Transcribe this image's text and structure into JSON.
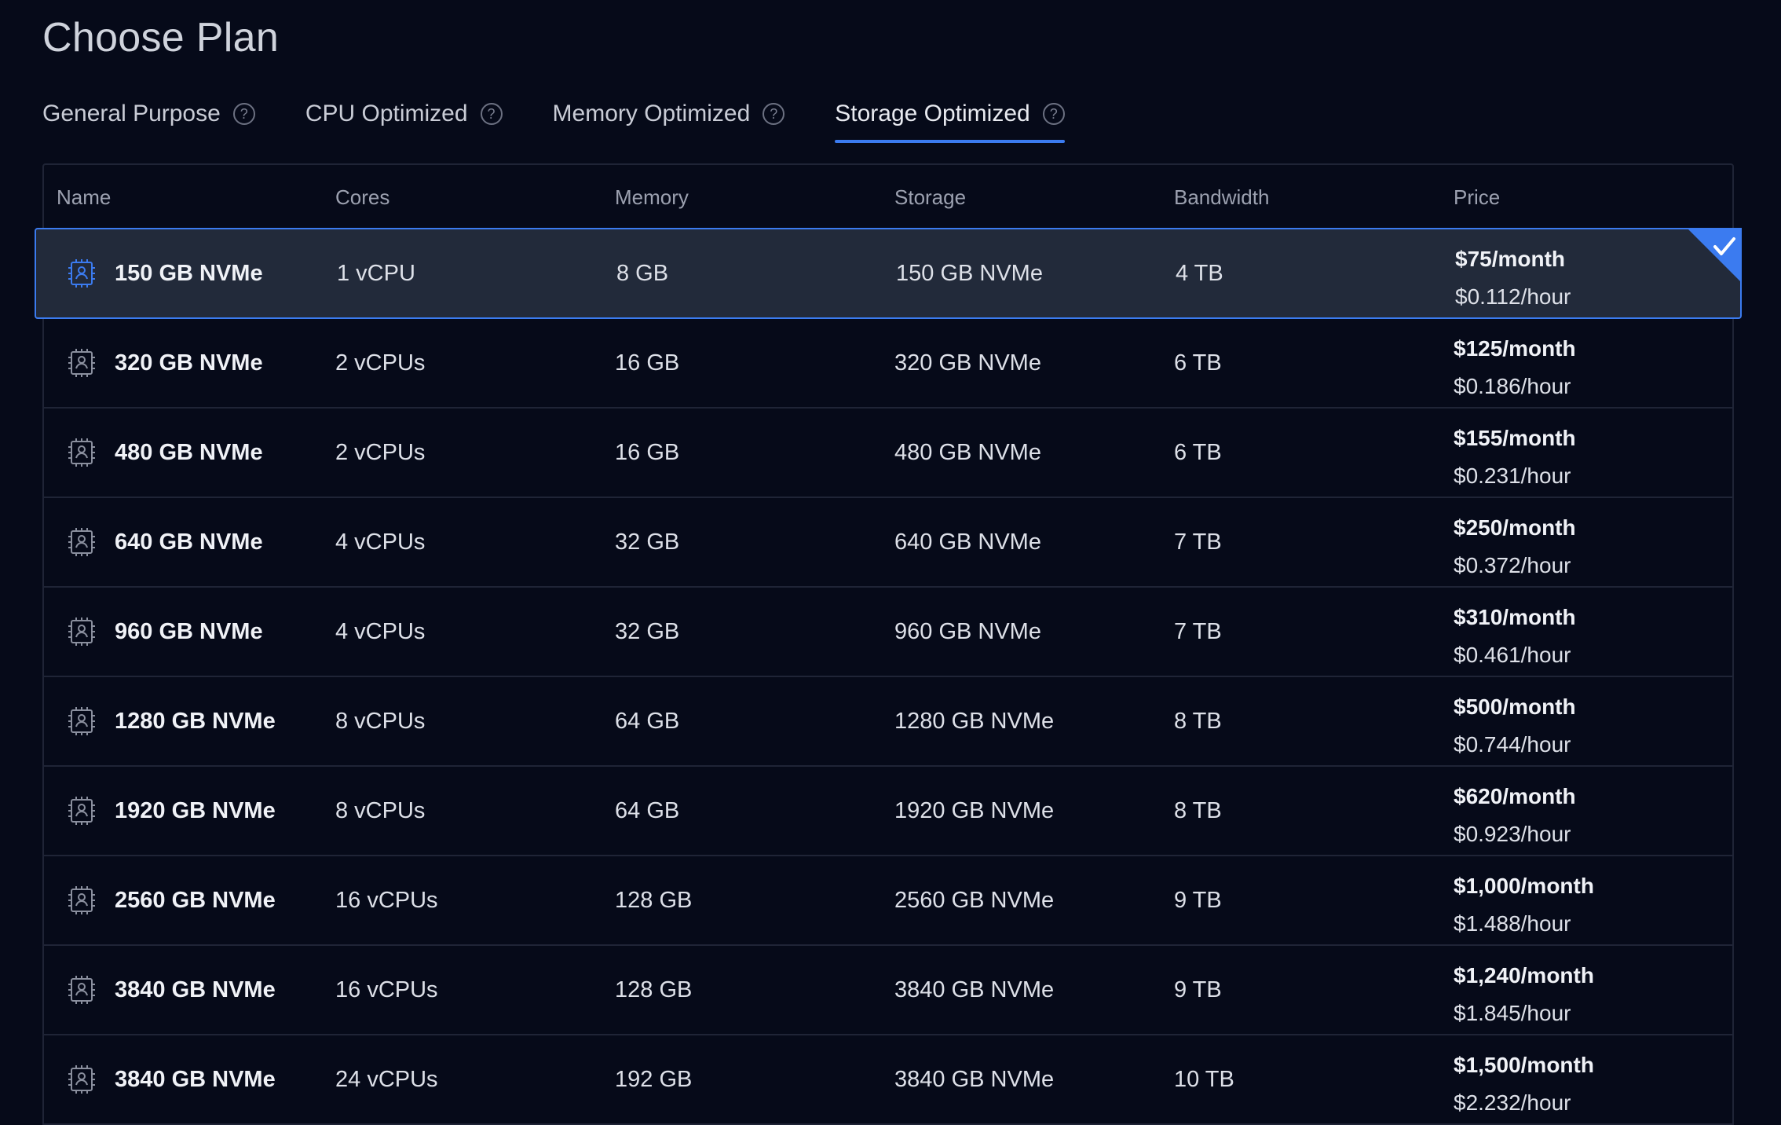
{
  "page": {
    "title": "Choose Plan"
  },
  "tabs": [
    {
      "label": "General Purpose",
      "help": "?"
    },
    {
      "label": "CPU Optimized",
      "help": "?"
    },
    {
      "label": "Memory Optimized",
      "help": "?"
    },
    {
      "label": "Storage Optimized",
      "help": "?",
      "active": true
    }
  ],
  "table": {
    "headers": {
      "name": "Name",
      "cores": "Cores",
      "memory": "Memory",
      "storage": "Storage",
      "bandwidth": "Bandwidth",
      "price": "Price"
    },
    "rows": [
      {
        "name": "150 GB NVMe",
        "cores": "1 vCPU",
        "memory": "8 GB",
        "storage": "150 GB NVMe",
        "bandwidth": "4 TB",
        "monthly": "$75/month",
        "hourly": "$0.112/hour",
        "selected": true
      },
      {
        "name": "320 GB NVMe",
        "cores": "2 vCPUs",
        "memory": "16 GB",
        "storage": "320 GB NVMe",
        "bandwidth": "6 TB",
        "monthly": "$125/month",
        "hourly": "$0.186/hour"
      },
      {
        "name": "480 GB NVMe",
        "cores": "2 vCPUs",
        "memory": "16 GB",
        "storage": "480 GB NVMe",
        "bandwidth": "6 TB",
        "monthly": "$155/month",
        "hourly": "$0.231/hour"
      },
      {
        "name": "640 GB NVMe",
        "cores": "4 vCPUs",
        "memory": "32 GB",
        "storage": "640 GB NVMe",
        "bandwidth": "7 TB",
        "monthly": "$250/month",
        "hourly": "$0.372/hour"
      },
      {
        "name": "960 GB NVMe",
        "cores": "4 vCPUs",
        "memory": "32 GB",
        "storage": "960 GB NVMe",
        "bandwidth": "7 TB",
        "monthly": "$310/month",
        "hourly": "$0.461/hour"
      },
      {
        "name": "1280 GB NVMe",
        "cores": "8 vCPUs",
        "memory": "64 GB",
        "storage": "1280 GB NVMe",
        "bandwidth": "8 TB",
        "monthly": "$500/month",
        "hourly": "$0.744/hour"
      },
      {
        "name": "1920 GB NVMe",
        "cores": "8 vCPUs",
        "memory": "64 GB",
        "storage": "1920 GB NVMe",
        "bandwidth": "8 TB",
        "monthly": "$620/month",
        "hourly": "$0.923/hour"
      },
      {
        "name": "2560 GB NVMe",
        "cores": "16 vCPUs",
        "memory": "128 GB",
        "storage": "2560 GB NVMe",
        "bandwidth": "9 TB",
        "monthly": "$1,000/month",
        "hourly": "$1.488/hour"
      },
      {
        "name": "3840 GB NVMe",
        "cores": "16 vCPUs",
        "memory": "128 GB",
        "storage": "3840 GB NVMe",
        "bandwidth": "9 TB",
        "monthly": "$1,240/month",
        "hourly": "$1.845/hour"
      },
      {
        "name": "3840 GB NVMe",
        "cores": "24 vCPUs",
        "memory": "192 GB",
        "storage": "3840 GB NVMe",
        "bandwidth": "10 TB",
        "monthly": "$1,500/month",
        "hourly": "$2.232/hour"
      }
    ]
  },
  "colors": {
    "accent": "#3b7bf0",
    "background": "#060a19",
    "selected_row": "#222a3a"
  },
  "icons": {
    "plan": "server-chip-icon",
    "selected": "check-icon",
    "help": "help-circle-icon"
  }
}
